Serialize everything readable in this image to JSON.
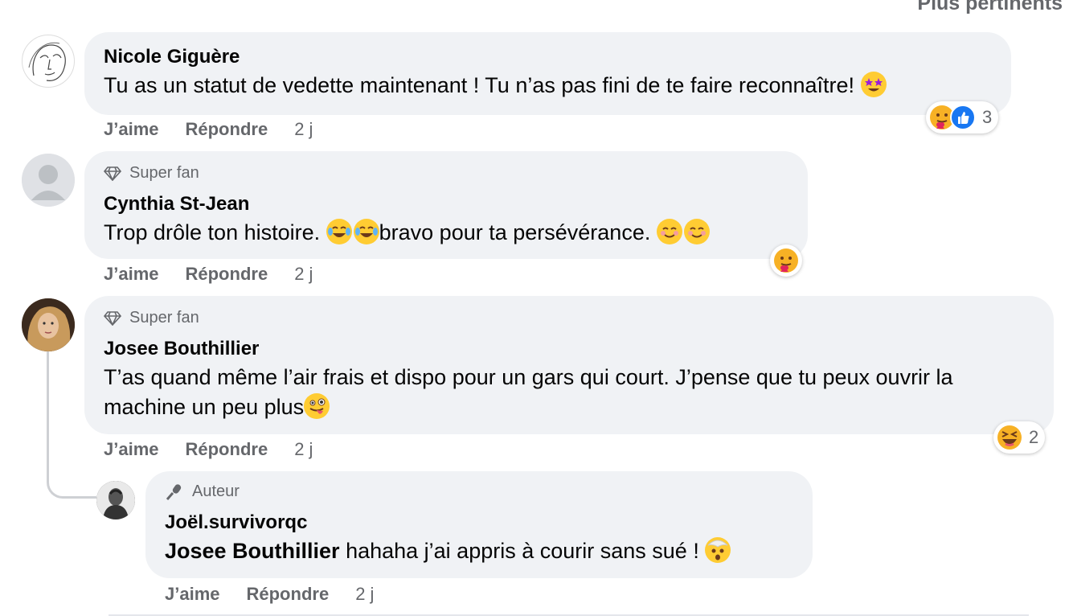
{
  "sort_label": "Plus pertinents",
  "actions": {
    "like": "J’aime",
    "reply": "Répondre"
  },
  "comments": [
    {
      "author": "Nicole Giguère",
      "text": "Tu as un statut de vedette maintenant ! Tu n’as pas fini de te faire reconnaître!",
      "time": "2 j",
      "reaction_count": "3",
      "reactions": [
        "care-emoji",
        "like-emoji"
      ]
    },
    {
      "badge": "Super fan",
      "author": "Cynthia St-Jean",
      "text_a": "Trop drôle ton histoire. ",
      "text_b": "bravo pour ta persévérance. ",
      "time": "2 j",
      "reactions": [
        "care-emoji"
      ]
    },
    {
      "badge": "Super fan",
      "author": "Josee Bouthillier",
      "text": "T’as quand même l’air frais et dispo pour un gars qui court. J’pense que tu peux ouvrir la machine un peu plus",
      "time": "2 j",
      "reaction_count": "2",
      "reactions": [
        "haha-emoji"
      ]
    },
    {
      "badge": "Auteur",
      "author": "Joël.survivorqc",
      "mention": "Josee Bouthillier",
      "text": " hahaha j’ai appris à courir sans sué ! ",
      "time": "2 j"
    }
  ],
  "colors": {
    "bubble": "#f0f2f5",
    "secondary_text": "#65676b",
    "like_blue": "#1877f2"
  }
}
